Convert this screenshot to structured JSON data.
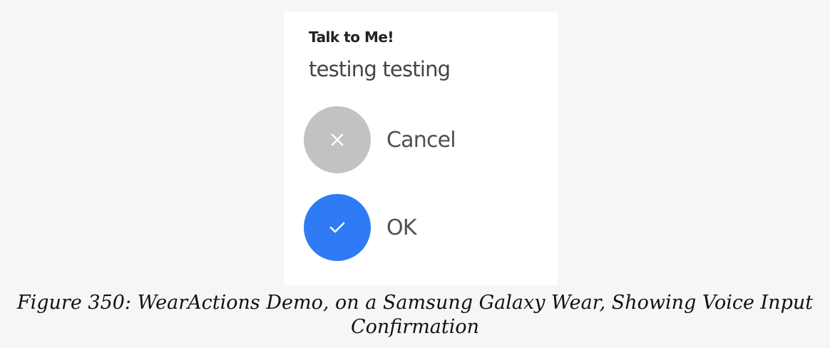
{
  "screen": {
    "title": "Talk to Me!",
    "transcript": "testing testing"
  },
  "actions": {
    "cancel": {
      "label": "Cancel",
      "icon": "close-icon",
      "color": "#c2c2c2"
    },
    "ok": {
      "label": "OK",
      "icon": "check-icon",
      "color": "#2f7bf5"
    }
  },
  "caption": {
    "line1": "Figure 350: WearActions Demo, on a Samsung Galaxy Wear, Showing Voice Input",
    "line2": "Confirmation"
  }
}
